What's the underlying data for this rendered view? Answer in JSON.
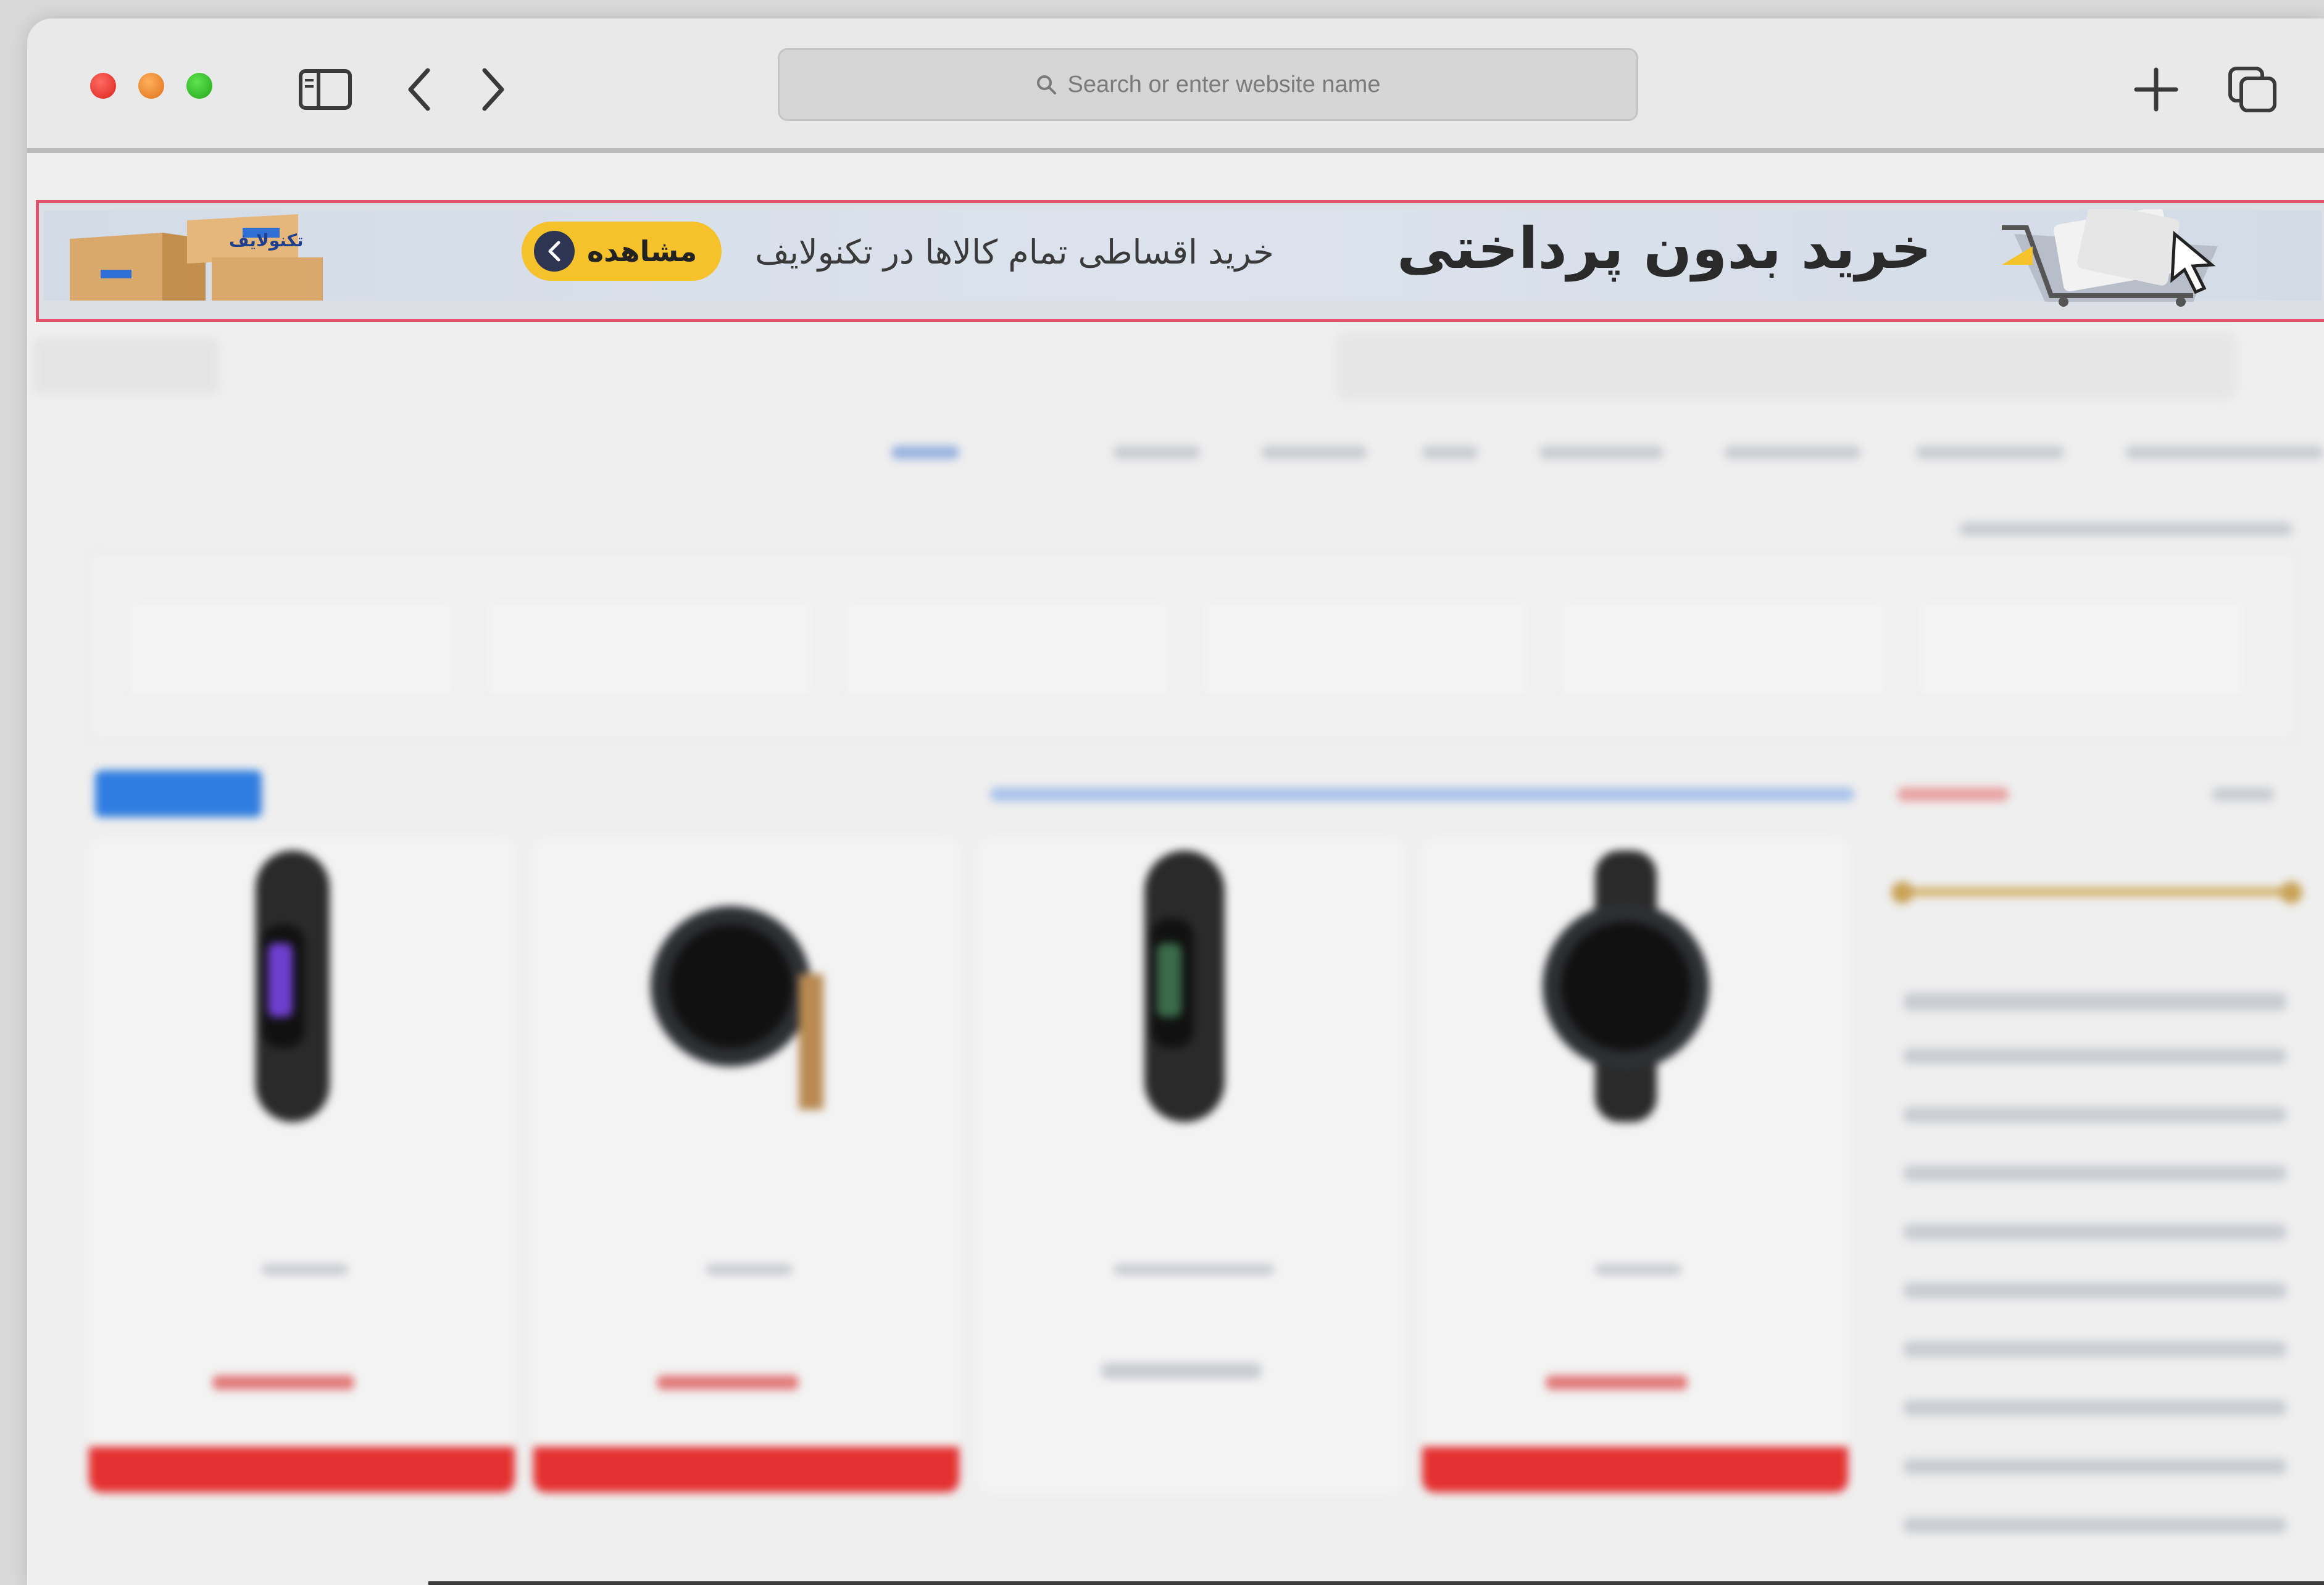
{
  "browser": {
    "address_placeholder": "Search or enter website name",
    "icons": [
      "sidebar-icon",
      "back-chevron-icon",
      "forward-chevron-icon",
      "search-icon",
      "new-tab-plus-icon",
      "tab-overview-icon"
    ]
  },
  "banner": {
    "title": "خرید بدون پرداختی",
    "subtitle": "خرید اقساطی تمام کالاها در تکنولایف",
    "button_label": "مشاهده",
    "brand_text": "تکنولایف",
    "highlight_color": "#e0546a",
    "button_color": "#f5c22b"
  },
  "page": {
    "note_color_sale": "#e43030",
    "accent_blue": "#2f7de0"
  }
}
